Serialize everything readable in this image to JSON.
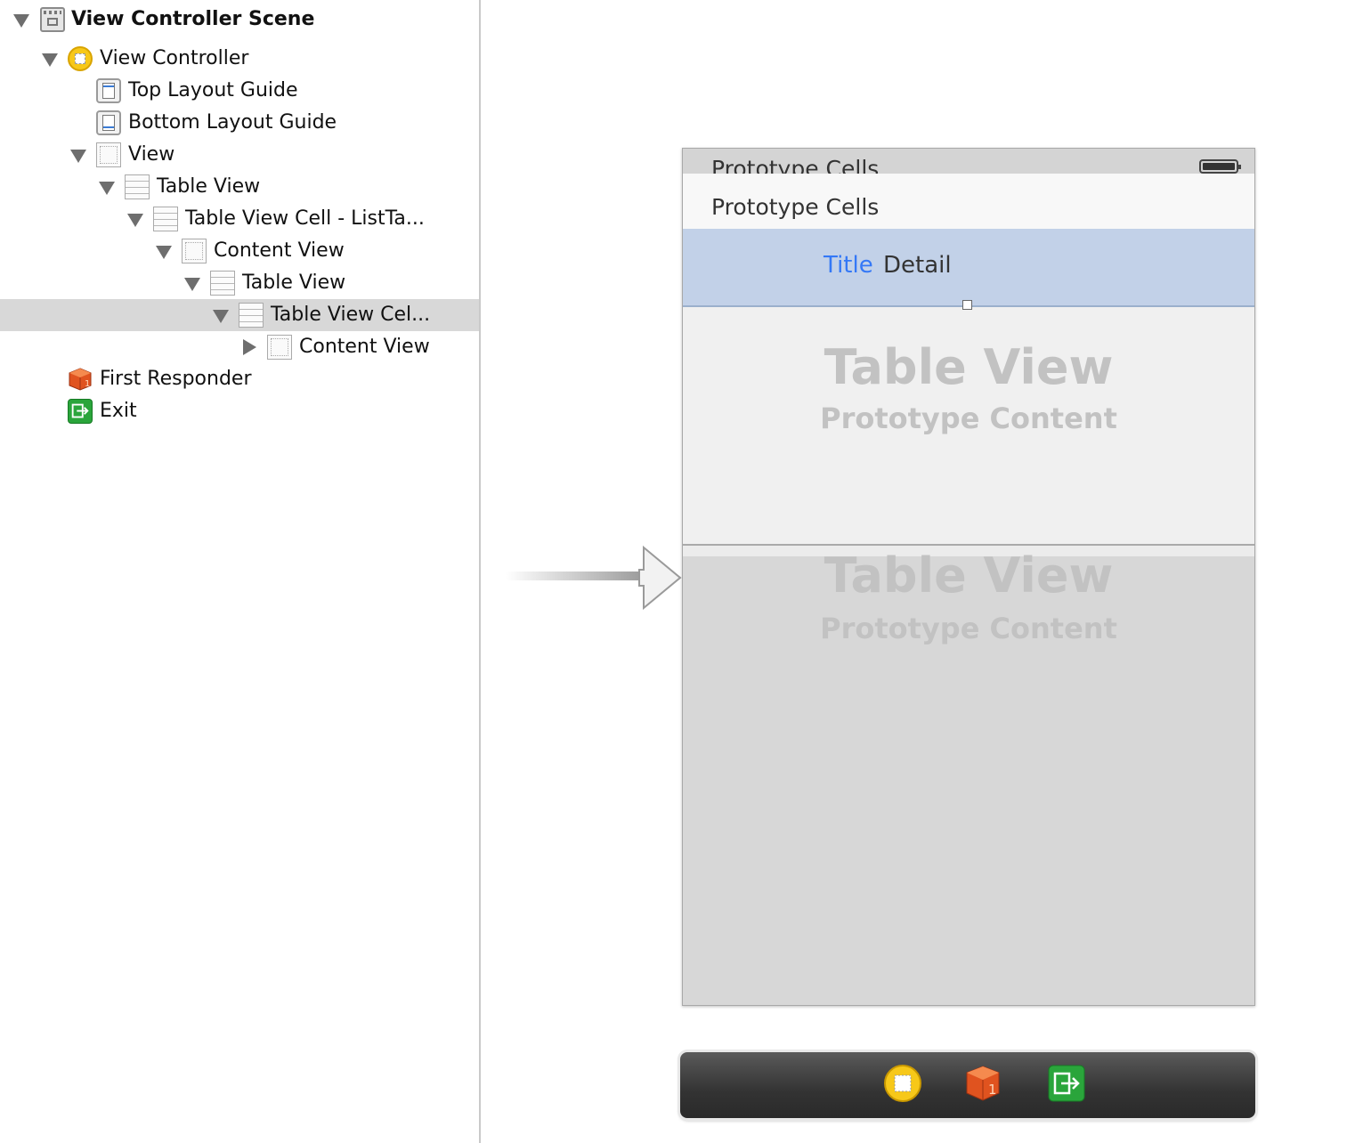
{
  "outline": {
    "items": [
      {
        "label": "View Controller Scene",
        "icon": "scene-icon",
        "disclosure": "open",
        "bold": true
      },
      {
        "label": "View Controller",
        "icon": "view-controller-icon",
        "disclosure": "open"
      },
      {
        "label": "Top Layout Guide",
        "icon": "top-layout-guide-icon",
        "disclosure": "none"
      },
      {
        "label": "Bottom Layout Guide",
        "icon": "bottom-layout-guide-icon",
        "disclosure": "none"
      },
      {
        "label": "View",
        "icon": "view-icon",
        "disclosure": "open"
      },
      {
        "label": "Table View",
        "icon": "table-view-icon",
        "disclosure": "open"
      },
      {
        "label": "Table View Cell - ListTa...",
        "icon": "table-view-cell-icon",
        "disclosure": "open"
      },
      {
        "label": "Content View",
        "icon": "content-view-icon",
        "disclosure": "open"
      },
      {
        "label": "Table View",
        "icon": "table-view-icon",
        "disclosure": "open"
      },
      {
        "label": "Table View Cel...",
        "icon": "table-view-cell-icon",
        "disclosure": "open",
        "selected": true
      },
      {
        "label": "Content View",
        "icon": "content-view-icon",
        "disclosure": "closed"
      },
      {
        "label": "First Responder",
        "icon": "first-responder-icon",
        "disclosure": "none"
      },
      {
        "label": "Exit",
        "icon": "exit-icon",
        "disclosure": "none"
      }
    ]
  },
  "canvas": {
    "status_header": "Prototype Cells",
    "section_header": "Prototype Cells",
    "cell": {
      "title": "Title",
      "detail": "Detail"
    },
    "outer_placeholder": {
      "title": "Table View",
      "subtitle": "Prototype Content"
    },
    "inner_placeholder": {
      "title": "Table View",
      "subtitle": "Prototype Content"
    },
    "dock_icons": [
      "view-controller-icon",
      "first-responder-icon",
      "exit-icon"
    ]
  },
  "colors": {
    "selection_row": "#d8d8d8",
    "selected_cell": "#c2d1e8",
    "title_blue": "#3478f6",
    "placeholder_gray": "#c2c2c2"
  }
}
